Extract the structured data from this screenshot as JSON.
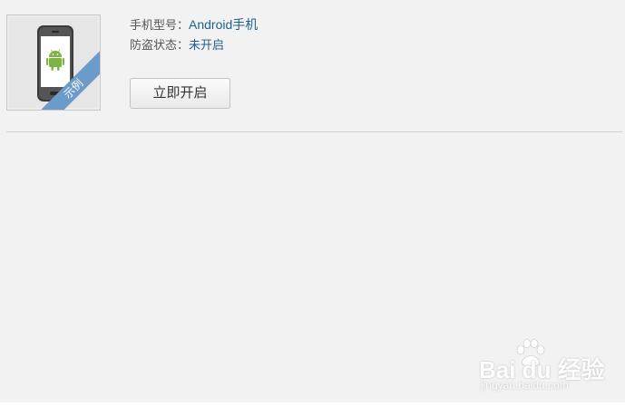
{
  "device": {
    "model_label": "手机型号：",
    "model_value": "Android手机",
    "status_label": "防盗状态：",
    "status_value": "未开启",
    "ribbon_text": "示例",
    "thumbnail_icon": "android-phone-icon"
  },
  "actions": {
    "enable_button_label": "立即开启"
  },
  "watermark": {
    "brand": "Bai du 经验",
    "url": "jingyan.baidu.com",
    "icon": "baidu-paw-icon"
  },
  "colors": {
    "panel_bg": "#f2f2f2",
    "value_text": "#1d5f8a",
    "ribbon": "#6d9bc9",
    "android_green": "#7cb342"
  }
}
